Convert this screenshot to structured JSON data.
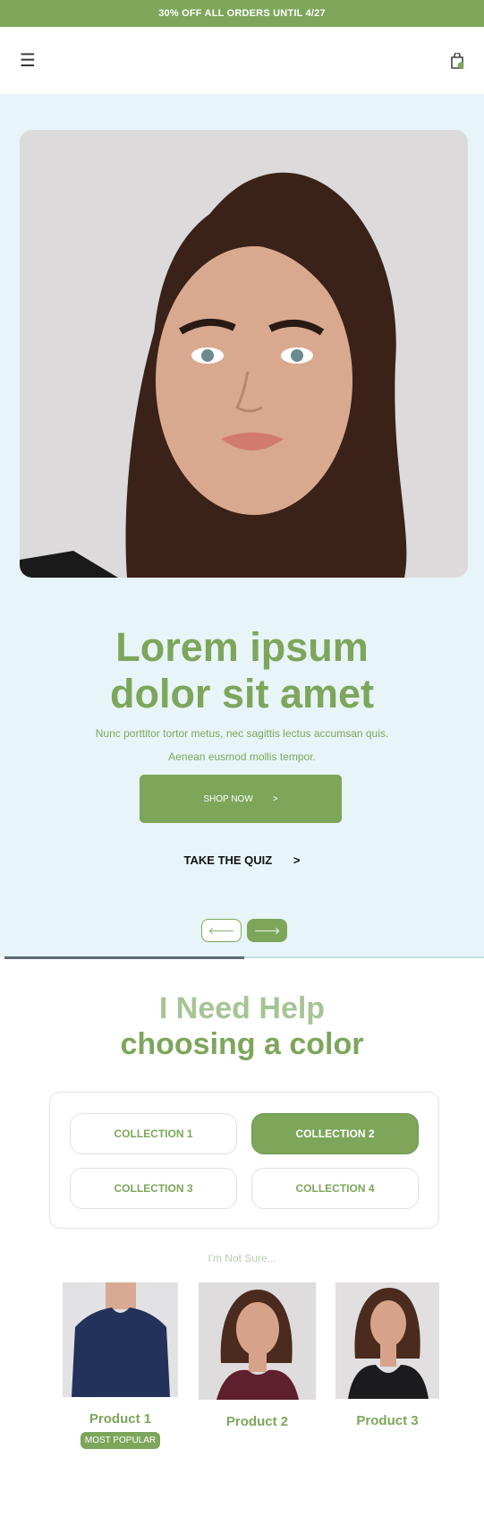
{
  "announcement": {
    "text": "30% OFF ALL ORDERS UNTIL 4/27"
  },
  "header": {
    "menu_icon": "hamburger-icon",
    "cart_icon": "shopping-bag-icon"
  },
  "hero": {
    "title_line1": "Lorem ipsum",
    "title_line2": "dolor sit amet",
    "description_line1": "Nunc porttitor tortor metus, nec sagittis lectus accumsan quis.",
    "description_line2": "Aenean eusmod mollis tempor.",
    "shop_button": {
      "label": "SHOP NOW",
      "arrow": ">"
    },
    "quiz_link": {
      "label": "TAKE THE QUIZ",
      "arrow": ">"
    },
    "nav": {
      "prev_icon": "arrow-left-icon",
      "next_icon": "arrow-right-icon",
      "prev_glyph": "🡐",
      "next_glyph": "🡒"
    },
    "slide_progress": 0.5
  },
  "help": {
    "title_line1": "I Need Help",
    "title_line2": "choosing a color",
    "collections": [
      {
        "label": "COLLECTION 1",
        "active": false
      },
      {
        "label": "COLLECTION 2",
        "active": true
      },
      {
        "label": "COLLECTION 3",
        "active": false
      },
      {
        "label": "COLLECTION 4",
        "active": false
      }
    ],
    "not_sure": "I'm Not Sure..."
  },
  "products": [
    {
      "name": "Product 1",
      "badge": "MOST POPULAR"
    },
    {
      "name": "Product 2"
    },
    {
      "name": "Product 3"
    }
  ],
  "colors": {
    "brand_green": "#7da65b",
    "hero_bg": "#e7f4f8",
    "light_green": "#a6c495"
  }
}
